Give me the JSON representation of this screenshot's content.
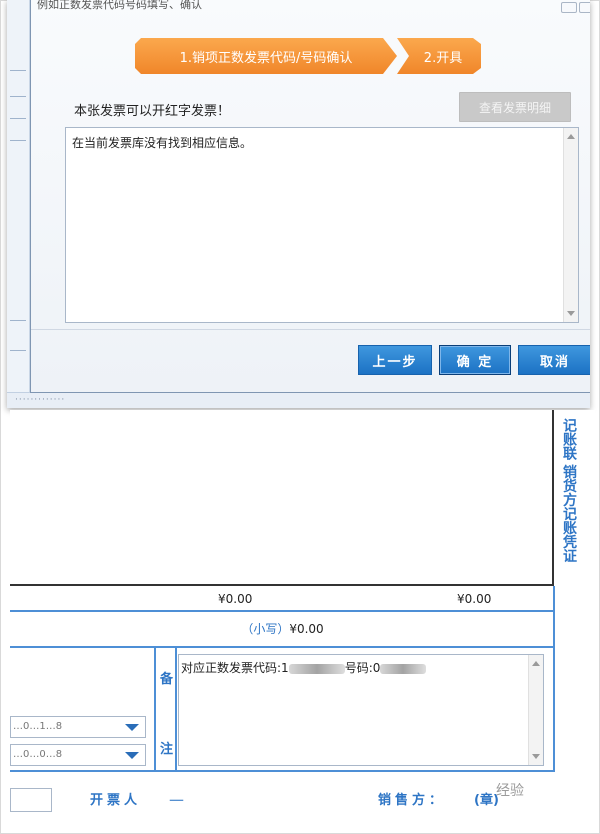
{
  "dialog": {
    "title": "例如正数发票代码号码填写、确认",
    "steps": [
      {
        "label": "1.销项正数发票代码/号码确认",
        "active": true
      },
      {
        "label": "2.开具",
        "active": true
      }
    ],
    "status_text": "本张发票可以开红字发票！",
    "view_detail_label": "查看发票明细",
    "message": "在当前发票库没有找到相应信息。",
    "buttons": {
      "prev": "上一步",
      "ok": "确 定",
      "cancel": "取消"
    },
    "accent_color": "#f0862a",
    "button_color": "#1c72c4"
  },
  "invoice": {
    "side_text": "记账联 销货方记账凭证",
    "amount_1": "¥0.00",
    "amount_2": "¥0.00",
    "small_total_label": "（小写）",
    "small_total_value": "¥0.00",
    "remark_label_top": "备",
    "remark_label_bottom": "注",
    "remark_prefix": "对应正数发票代码:1",
    "remark_mid": "号码:0",
    "combo_1": "…0…1…8",
    "combo_2": "…0…0…8",
    "drawer_label": "开票人",
    "drawer_value": "＿",
    "seller_label": "销售方：",
    "seller_value": "(章)",
    "watermark": "经验",
    "line_color": "#4d8fd6",
    "label_color": "#2e75c5"
  }
}
